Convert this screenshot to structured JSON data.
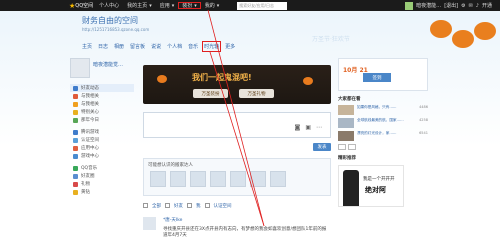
{
  "topbar": {
    "brand": "QQ空间",
    "items": [
      "个人中心",
      "我的主页",
      "应用",
      "装扮",
      "我的"
    ],
    "search_placeholder": "搜索好友/应用/日志",
    "username": "暗夜潜能…",
    "logout": "[退出]",
    "right_label": "开通"
  },
  "site": {
    "title": "财务自由的空间",
    "url": "http://1251716853.qzone.qq.com",
    "nav": [
      "主页",
      "日志",
      "相册",
      "留言板",
      "说说",
      "个人档",
      "音乐",
      "时光轴",
      "更多"
    ],
    "watermark": "万圣节·狂欢节"
  },
  "profile": {
    "name": "暗夜潜能觉…"
  },
  "left_menu": [
    "好友动态",
    "与我相关",
    "与我相关",
    "特别关心",
    "那年今日",
    "腾讯游戏",
    "认证空间",
    "应用中心",
    "游戏中心",
    "QQ音乐",
    "好友圈",
    "礼物",
    "黄钻"
  ],
  "banner": {
    "title": "我们一起鬼混吧!",
    "btn1": "万圣装扮",
    "btn2": "万圣礼物"
  },
  "composer": {
    "publish_label": "发表"
  },
  "recommend": {
    "label": "可能想认识的搬家达人"
  },
  "filters": [
    "全部",
    "好友",
    "我",
    "认证空间"
  ],
  "feed": {
    "name": "*唐-天Ike",
    "text": "寻找重庆开县还在3X点开县内有志向，有梦想的我会如喜欢创意/想团队1年前的报道年4月7天"
  },
  "right": {
    "date": "10月 21",
    "sign_btn": "签到",
    "section": "大家都在看",
    "items": [
      {
        "text": "如果你是风格，只有……",
        "count": "4486"
      },
      {
        "text": "全球航线最美的航，国家……",
        "count": "4258"
      },
      {
        "text": "漂亮的灯光设计，家……",
        "count": "6541"
      }
    ],
    "ad_header": "精彩推荐",
    "ad_line1": "我是一个开开开",
    "ad_line2": "绝对阿"
  }
}
